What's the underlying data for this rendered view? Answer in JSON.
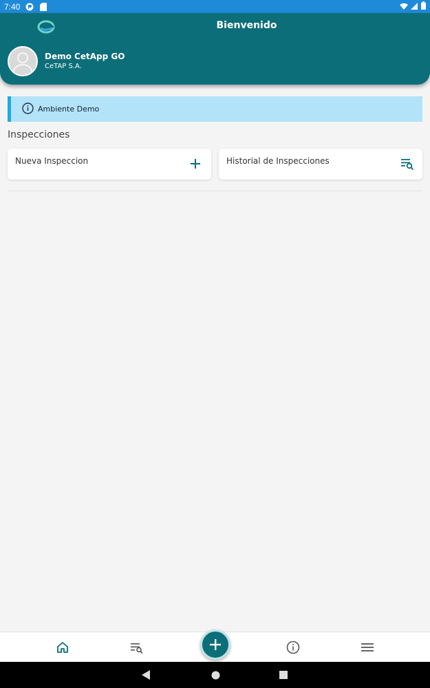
{
  "status_bar": {
    "time": "7:40"
  },
  "header": {
    "title": "Bienvenido",
    "user_name": "Demo CetApp GO",
    "company": "CeTAP S.A."
  },
  "banner": {
    "text": "Ambiente Demo"
  },
  "section": {
    "title": "Inspecciones"
  },
  "cards": {
    "new_inspection": "Nueva Inspeccion",
    "history": "Historial de Inspecciones"
  },
  "colors": {
    "primary": "#0c6e79",
    "banner_bg": "#b3e3f8",
    "banner_accent": "#21a9e0",
    "status_bar": "#1f8ad8"
  },
  "icons": {
    "nav": [
      "home-icon",
      "search-list-icon",
      "add-icon",
      "info-icon",
      "menu-icon"
    ],
    "system": [
      "back-icon",
      "home-circle-icon",
      "recents-icon"
    ]
  }
}
